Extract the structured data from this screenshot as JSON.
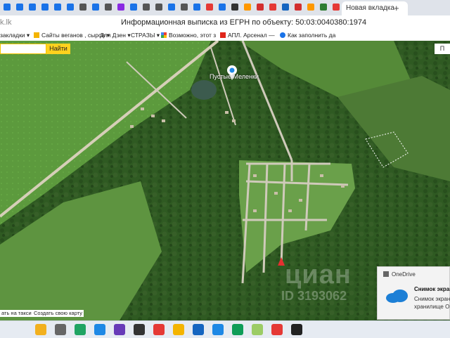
{
  "window": {
    "domain_fragment": "k.lk",
    "title": "Информационная выписка из ЕГРН по объекту: 50:03:0040380:1974"
  },
  "newtab_label": "Новая вкладка",
  "new_tab_plus": "+",
  "bookmarks": [
    {
      "label": "закладки",
      "icon_color": "#f4b400"
    },
    {
      "label": "Сайты веганов , сыров",
      "icon_color": "#f4b400"
    },
    {
      "label": "Для Дзен",
      "icon_color": "#f4b400"
    },
    {
      "label": "СТРАЗЫ",
      "icon_color": "#f4b400"
    },
    {
      "label": "Возможно, этот з",
      "icon_color": "#ea4335"
    },
    {
      "label": "АПЛ. Арсенал —",
      "icon_color": "#e0261a"
    },
    {
      "label": "Как заполнить да",
      "icon_color": "#1a73e8"
    }
  ],
  "map": {
    "search_button": "Найти",
    "p_button": "П",
    "place_name": "Пустые Меленки",
    "link_taxi": "ать на такси",
    "link_share": "Создать свою карту",
    "watermark_line1": "циан",
    "watermark_line2": "ID 3193062"
  },
  "toast": {
    "app": "OneDrive",
    "title": "Снимок экрана",
    "body_line1": "Снимок экран",
    "body_line2": "хранилище О"
  },
  "taskbar": {
    "icons": [
      "weather-icon",
      "virtual-desktop-icon",
      "l-app-icon",
      "mail-icon",
      "photos-icon",
      "app-icon",
      "yandex-icon",
      "files-icon",
      "phone-icon",
      "check-icon",
      "edge-icon",
      "tools-icon",
      "yandex-browser-icon",
      "media-player-icon"
    ]
  }
}
